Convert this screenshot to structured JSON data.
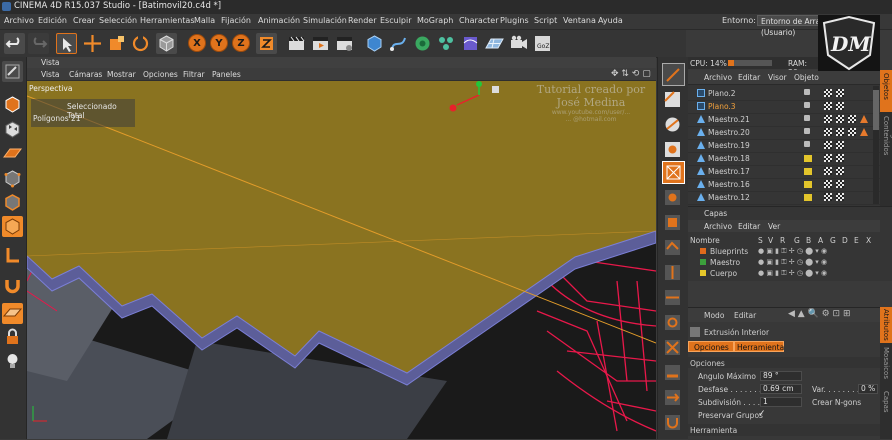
{
  "window": {
    "title": "CINEMA 4D R15.037 Studio - [Batimovil20.c4d *]"
  },
  "menubar": {
    "items": [
      "Archivo",
      "Edición",
      "Crear",
      "Selección",
      "Herramientas",
      "Malla",
      "Fijación",
      "Animación",
      "Simulación",
      "Render",
      "Esculpir",
      "MoGraph",
      "Character",
      "Plugins",
      "Script",
      "Ventana",
      "Ayuda"
    ],
    "entorno_label": "Entorno:",
    "entorno_value": "Entorno de Arranque (Usuario)"
  },
  "toolbar": {
    "axis_x": "X",
    "axis_y": "Y",
    "axis_z": "Z"
  },
  "viewport": {
    "panel_title": "Vista",
    "menu": [
      "Vista",
      "Cámaras",
      "Mostrar",
      "Opciones",
      "Filtrar",
      "Paneles"
    ],
    "camera_label": "Perspectiva",
    "stats_header": "Seleccionado Total",
    "stats_label": "Polígonos",
    "stats_value": "21",
    "watermark_line1": "Tutorial creado por",
    "watermark_line2": "José Medina",
    "watermark_line3": "www.youtube.com/user/...",
    "watermark_line4": "... @hotmail.com"
  },
  "status": {
    "cpu_label": "CPU: 14%",
    "ram_label": "RAM: 36"
  },
  "object_manager": {
    "menu": [
      "Archivo",
      "Editar",
      "Visor",
      "Objeto"
    ],
    "objects": [
      {
        "name": "Plano.2",
        "active": false,
        "yellow": false
      },
      {
        "name": "Plano.3",
        "active": true,
        "yellow": false
      },
      {
        "name": "Maestro.21",
        "active": false,
        "yellow": false
      },
      {
        "name": "Maestro.20",
        "active": false,
        "yellow": false
      },
      {
        "name": "Maestro.19",
        "active": false,
        "yellow": false
      },
      {
        "name": "Maestro.18",
        "active": false,
        "yellow": true
      },
      {
        "name": "Maestro.17",
        "active": false,
        "yellow": true
      },
      {
        "name": "Maestro.16",
        "active": false,
        "yellow": true
      },
      {
        "name": "Maestro.12",
        "active": false,
        "yellow": true
      }
    ]
  },
  "layers": {
    "title": "Capas",
    "menu": [
      "Archivo",
      "Editar",
      "Ver"
    ],
    "columns": [
      "Nombre",
      "S",
      "V",
      "R",
      "G",
      "B",
      "A",
      "G",
      "D",
      "E",
      "X"
    ],
    "rows": [
      {
        "name": "Blueprints",
        "color": "#e06a1c"
      },
      {
        "name": "Maestro",
        "color": "#3ca03c"
      },
      {
        "name": "Cuerpo",
        "color": "#e5c72a"
      }
    ]
  },
  "attributes": {
    "menu": [
      "Modo",
      "Editar"
    ],
    "tool_name": "Extrusión Interior",
    "tabs": [
      "Opciones",
      "Herramienta"
    ],
    "section_opciones": "Opciones",
    "angulo_label": "Angulo Máximo",
    "angulo_value": "89 °",
    "desfase_label": "Desfase . . . . . . .",
    "desfase_value": "0.69 cm",
    "var_label": "Var. . . . . . . . .",
    "var_value": "0 %",
    "subdiv_label": "Subdivisión . . . .",
    "subdiv_value": "1",
    "ngons_label": "Crear N-gons",
    "preservar_label": "Preservar Grupos",
    "preservar_check": "✓",
    "section_herramienta": "Herramienta"
  },
  "side_tabs": {
    "top": [
      "Objetos",
      "Navegador de Contenidos",
      "Estructura"
    ],
    "bottom": [
      "Atributos",
      "Mosaicos",
      "Capas"
    ]
  },
  "logo_text": "DM"
}
